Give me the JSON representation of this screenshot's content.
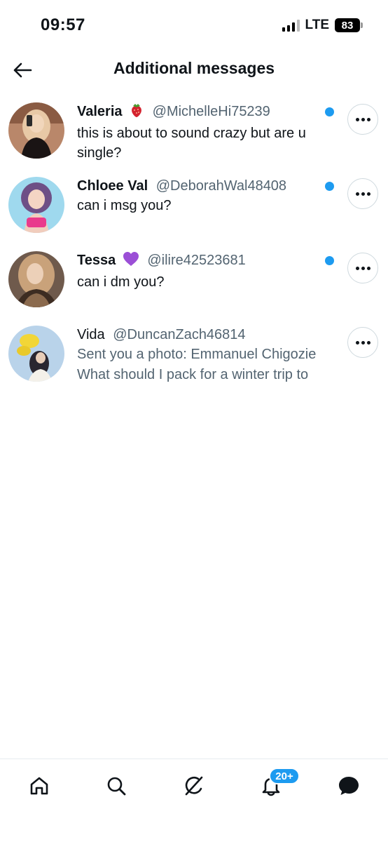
{
  "status_bar": {
    "time": "09:57",
    "network": "LTE",
    "battery": "83"
  },
  "header": {
    "title": "Additional messages",
    "back_icon": "arrow-left-icon"
  },
  "messages": [
    {
      "name": "Valeria",
      "emoji": "strawberry",
      "handle": "@MichelleHi75239",
      "preview": "this is about to sound crazy but are u single?",
      "unread": true
    },
    {
      "name": "Chloee Val",
      "handle": "@DeborahWal48408",
      "preview": "can i msg you?",
      "unread": true
    },
    {
      "name": "Tessa",
      "emoji": "purple-heart",
      "handle": "@ilire42523681",
      "preview": "can i dm you?",
      "unread": true
    },
    {
      "name": "Vida",
      "handle": "@DuncanZach46814",
      "preview_line1": "Sent you a photo: Emmanuel Chigozie",
      "preview_line2": "What should I pack for a winter trip to",
      "unread": false
    }
  ],
  "tab_bar": {
    "notifications_badge": "20+",
    "icons": [
      "home-icon",
      "search-icon",
      "grok-icon",
      "notifications-icon",
      "messages-icon"
    ]
  },
  "colors": {
    "accent": "#1d9bf0",
    "text": "#0f1419",
    "muted": "#536471"
  }
}
